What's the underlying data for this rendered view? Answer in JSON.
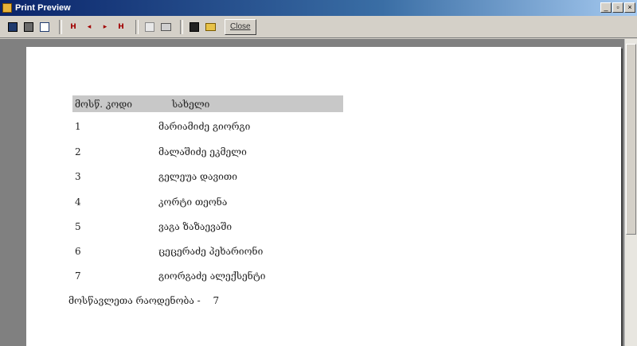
{
  "window": {
    "title": "Print Preview",
    "controls": {
      "minimize": "_",
      "restore": "▫",
      "close": "×"
    }
  },
  "toolbar": {
    "icons": [
      "page-view-icon",
      "two-page-icon",
      "multi-page-icon",
      "first-page-icon",
      "prev-page-icon",
      "next-page-icon",
      "last-page-icon",
      "zoom-icon",
      "print-icon",
      "save-icon",
      "open-icon"
    ],
    "nav_first": "H",
    "nav_prev": "◂",
    "nav_next": "▸",
    "nav_last": "H",
    "close_label": "Close"
  },
  "report": {
    "headers": {
      "code": "მოსწ. კოდი",
      "name": "სახელი"
    },
    "rows": [
      {
        "code": "1",
        "name": "მარიამიძე გიორგი"
      },
      {
        "code": "2",
        "name": "მალაშიძე ეკმელი"
      },
      {
        "code": "3",
        "name": "გელეუა დავითი"
      },
      {
        "code": "4",
        "name": "კორტი თეონა"
      },
      {
        "code": "5",
        "name": "ვაგა ზაზაევაში"
      },
      {
        "code": "6",
        "name": "ცეცერაძე პეხარიონი"
      },
      {
        "code": "7",
        "name": "გიორგაძე ალექსენტი"
      }
    ],
    "footer_label": "მოსწავლეთა რაოდენობა -",
    "footer_count": "7"
  }
}
